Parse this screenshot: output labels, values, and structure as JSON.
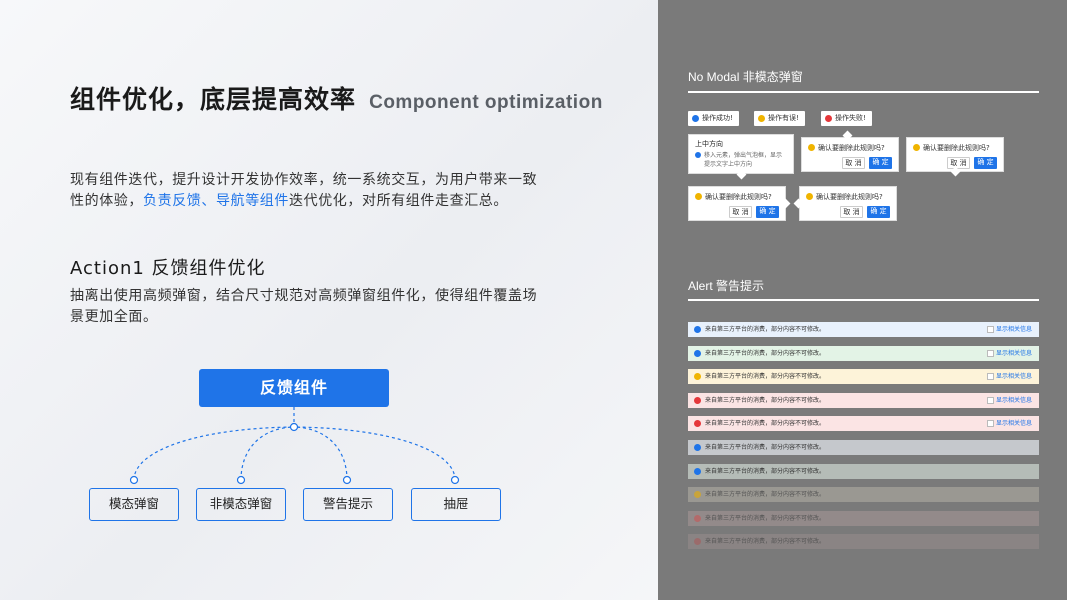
{
  "title": {
    "cn": "组件优化，底层提高效率",
    "en": "Component optimization"
  },
  "intro": {
    "p1_a": "现有组件迭代，提升设计开发协作效率，统一系统交互，为用户带来一致性的体验，",
    "p1_hl": "负责反馈、导航等组件",
    "p1_b": "迭代优化，对所有组件走查汇总。"
  },
  "action": {
    "title": "Action1 反馈组件优化",
    "desc": "抽离出使用高频弹窗，结合尺寸规范对高频弹窗组件化，使得组件覆盖场景更加全面。"
  },
  "tree": {
    "root": "反馈组件",
    "leaves": [
      "模态弹窗",
      "非模态弹窗",
      "警告提示",
      "抽屉"
    ]
  },
  "no_modal": {
    "title": "No Modal 非模态弹窗",
    "toasts": [
      {
        "label": "操作成功!",
        "color": "#1f74e8"
      },
      {
        "label": "操作有误!",
        "color": "#f0b400"
      },
      {
        "label": "操作失败!",
        "color": "#e5373a"
      }
    ],
    "tooltip": {
      "title": "上中方向",
      "line1": "移入元素，弹出气泡框，显示",
      "line2": "提示文字上中方向"
    },
    "confirm": {
      "question": "确认要删除此规则吗?",
      "cancel": "取 消",
      "ok": "确 定"
    }
  },
  "alert": {
    "title": "Alert 警告提示",
    "message": "来自第三方平台的消费，部分内容不可修改。",
    "link": "显示相关信息",
    "rows": [
      {
        "bg": "#e8f1fc",
        "icon": "#1f74e8",
        "link": true
      },
      {
        "bg": "#e3f3e6",
        "icon": "#1f74e8",
        "link": true
      },
      {
        "bg": "#fdf3d9",
        "icon": "#f0b400",
        "link": true
      },
      {
        "bg": "#fbe4e4",
        "icon": "#e5373a",
        "link": true
      },
      {
        "bg": "#fbe4e4",
        "icon": "#e5373a",
        "link": true
      },
      {
        "bg": "#c5c8cc",
        "icon": "#1f74e8",
        "link": false
      },
      {
        "bg": "#b5bcb7",
        "icon": "#1f74e8",
        "link": false
      },
      {
        "bg": "#9a9892",
        "icon": "#c9a43a",
        "link": false
      },
      {
        "bg": "#938a8a",
        "icon": "#b36a6a",
        "link": false
      },
      {
        "bg": "#8a8484",
        "icon": "#9b6b6b",
        "link": false
      }
    ]
  }
}
